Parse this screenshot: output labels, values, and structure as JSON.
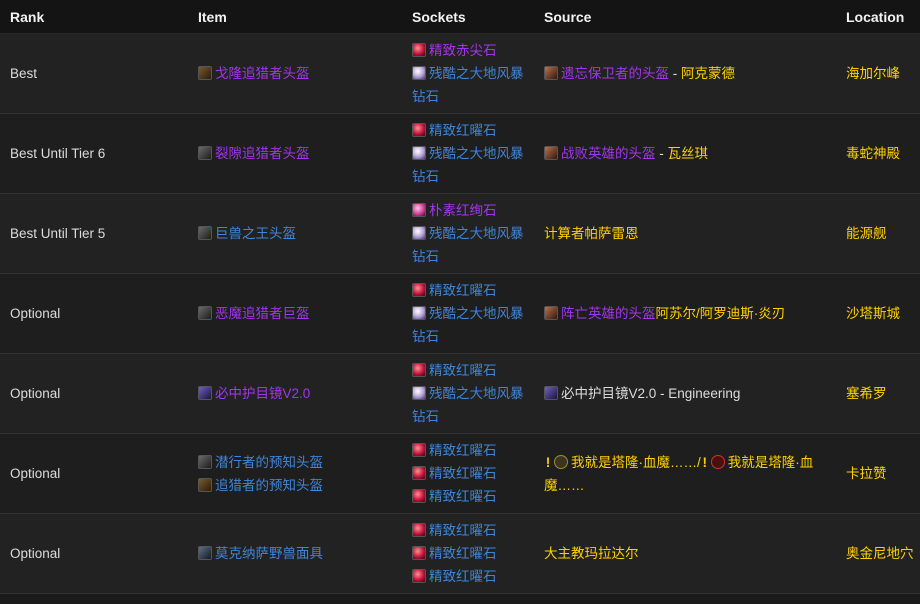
{
  "headers": {
    "rank": "Rank",
    "item": "Item",
    "sockets": "Sockets",
    "source": "Source",
    "location": "Location"
  },
  "rows": [
    {
      "rank": "Best",
      "items": [
        "戈隆追猎者头盔"
      ],
      "sockets": [
        "精致赤尖石",
        "残酷之大地风暴钻石"
      ],
      "source_item": "遗忘保卫者的头盔",
      "source_sep": " - ",
      "source_npc": "阿克蒙德",
      "location": "海加尔峰"
    },
    {
      "rank": "Best Until Tier 6",
      "items": [
        "裂隙追猎者头盔"
      ],
      "sockets": [
        "精致红曜石",
        "残酷之大地风暴钻石"
      ],
      "source_item": "战败英雄的头盔",
      "source_sep": " - ",
      "source_npc": "瓦丝琪",
      "location": "毒蛇神殿"
    },
    {
      "rank": "Best Until Tier 5",
      "items": [
        "巨兽之王头盔"
      ],
      "sockets": [
        "朴素红绚石",
        "残酷之大地风暴钻石"
      ],
      "source_npc": "计算者帕萨雷恩",
      "location": "能源舰"
    },
    {
      "rank": "Optional",
      "items": [
        "恶魔追猎者巨盔"
      ],
      "sockets": [
        "精致红曜石",
        "残酷之大地风暴钻石"
      ],
      "source_item": "阵亡英雄的头盔",
      "source_npc": "阿苏尔/阿罗迪斯·炎刃",
      "location": "沙塔斯城"
    },
    {
      "rank": "Optional",
      "items": [
        "必中护目镜V2.0"
      ],
      "sockets": [
        "精致红曜石",
        "残酷之大地风暴钻石"
      ],
      "source_item": "必中护目镜V2.0",
      "source_suffix": " - Engineering",
      "location": "塞希罗"
    },
    {
      "rank": "Optional",
      "items": [
        "潜行者的预知头盔",
        "追猎者的预知头盔"
      ],
      "sockets": [
        "精致红曜石",
        "精致红曜石",
        "精致红曜石"
      ],
      "quest_alli": "我就是塔隆·血魔……/",
      "quest_horde": "我就是塔隆·血魔……",
      "location": "卡拉赞"
    },
    {
      "rank": "Optional",
      "items": [
        "莫克纳萨野兽面具"
      ],
      "sockets": [
        "精致红曜石",
        "精致红曜石",
        "精致红曜石"
      ],
      "source_npc": "大主教玛拉达尔",
      "location": "奥金尼地穴"
    }
  ]
}
